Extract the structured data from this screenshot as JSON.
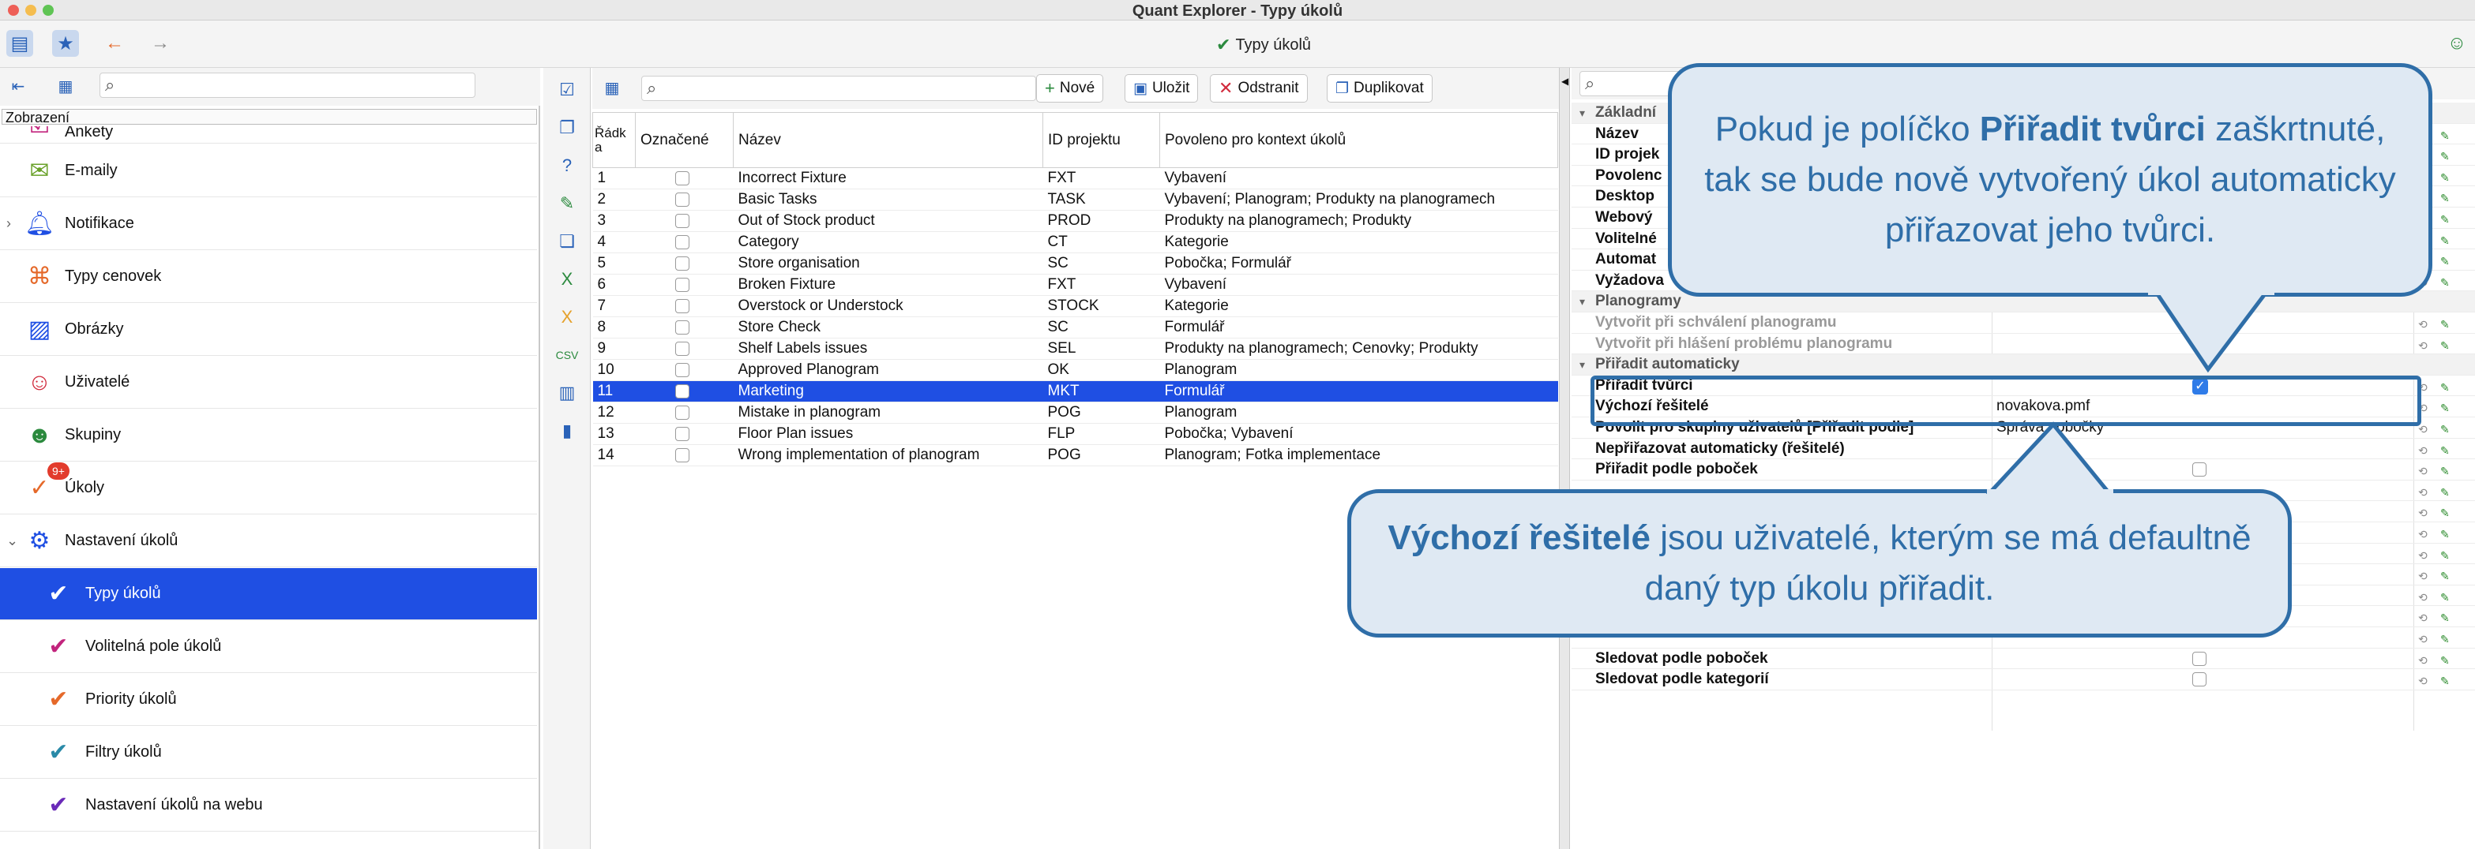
{
  "window": {
    "title": "Quant Explorer - Typy úkolů"
  },
  "toolbar": {
    "center_title": "Typy úkolů"
  },
  "left": {
    "search_placeholder": "",
    "view_label": "Zobrazení",
    "items": [
      {
        "label": "Ankety",
        "icon": "survey-icon"
      },
      {
        "label": "E-maily",
        "icon": "mail-icon"
      },
      {
        "label": "Notifikace",
        "icon": "bell-icon"
      },
      {
        "label": "Typy cenovek",
        "icon": "price-tag-icon"
      },
      {
        "label": "Obrázky",
        "icon": "image-icon"
      },
      {
        "label": "Uživatelé",
        "icon": "user-icon"
      },
      {
        "label": "Skupiny",
        "icon": "group-icon"
      },
      {
        "label": "Úkoly",
        "icon": "task-icon",
        "badge": "9+"
      },
      {
        "label": "Nastavení úkolů",
        "icon": "task-settings-icon"
      },
      {
        "label": "Typy úkolů",
        "icon": "task-type-icon"
      },
      {
        "label": "Volitelná pole úkolů",
        "icon": "optional-fields-icon"
      },
      {
        "label": "Priority úkolů",
        "icon": "priority-icon"
      },
      {
        "label": "Filtry úkolů",
        "icon": "filter-icon"
      },
      {
        "label": "Nastavení úkolů na webu",
        "icon": "web-settings-icon"
      }
    ]
  },
  "middle": {
    "buttons": {
      "new": "Nové",
      "save": "Uložit",
      "delete": "Odstranit",
      "duplicate": "Duplikovat"
    },
    "columns": [
      "Řádk a",
      "Označené",
      "Název",
      "ID projektu",
      "Povoleno pro kontext úkolů"
    ],
    "rows": [
      [
        "1",
        "Incorrect Fixture",
        "FXT",
        "Vybavení"
      ],
      [
        "2",
        "Basic Tasks",
        "TASK",
        "Vybavení; Planogram; Produkty na planogramech"
      ],
      [
        "3",
        "Out of Stock product",
        "PROD",
        "Produkty na planogramech; Produkty"
      ],
      [
        "4",
        "Category",
        "CT",
        "Kategorie"
      ],
      [
        "5",
        "Store organisation",
        "SC",
        "Pobočka; Formulář"
      ],
      [
        "6",
        "Broken Fixture",
        "FXT",
        "Vybavení"
      ],
      [
        "7",
        "Overstock or Understock",
        "STOCK",
        "Kategorie"
      ],
      [
        "8",
        "Store Check",
        "SC",
        "Formulář"
      ],
      [
        "9",
        "Shelf Labels issues",
        "SEL",
        "Produkty na planogramech; Cenovky; Produkty"
      ],
      [
        "10",
        "Approved Planogram",
        "OK",
        "Planogram"
      ],
      [
        "11",
        "Marketing",
        "MKT",
        "Formulář"
      ],
      [
        "12",
        "Mistake in planogram",
        "POG",
        "Planogram"
      ],
      [
        "13",
        "Floor Plan issues",
        "FLP",
        "Pobočka; Vybavení"
      ],
      [
        "14",
        "Wrong implementation of planogram",
        "POG",
        "Planogram; Fotka implementace"
      ]
    ],
    "selected_row": "11"
  },
  "right": {
    "group_basic": "Základní",
    "basic_keys": [
      "Název",
      "ID projek",
      "Povolenc",
      "Desktop",
      "Webový",
      "Volitelné",
      "Automat",
      "Vyžadova"
    ],
    "group_planograms": "Planogramy",
    "planogram_keys": [
      "Vytvořit při schválení planogramu",
      "Vytvořit při hlášení problému planogramu"
    ],
    "group_assign": "Přiřadit automaticky",
    "assign_creator": "Přiřadit tvůrci",
    "default_solvers": "Výchozí řešitelé",
    "default_solvers_value": "novakova.pmf",
    "allow_groups": "Povolit pro skupiny uživatelů [Přiřadit podle]",
    "allow_groups_value": "Správa pobočky",
    "no_auto": "Nepřiřazovat automaticky (řešitelé)",
    "by_branch": "Přiřadit podle poboček",
    "track_branch": "Sledovat podle poboček",
    "track_category": "Sledovat podle kategorií"
  },
  "callouts": {
    "top_pre": "Pokud je políčko ",
    "top_bold": "Přiřadit tvůrci",
    "top_post": " zaškrtnuté, tak se bude nově vytvořený úkol automaticky přiřazovat jeho tvůrci.",
    "bottom_bold": "Výchozí řešitelé",
    "bottom_post": " jsou uživatelé, kterým se má defaultně daný typ úkolu přiřadit."
  },
  "colors": {
    "accent": "#1f4fe3",
    "callout": "#2f6ea8",
    "callout_bg": "#dfe9f3"
  }
}
